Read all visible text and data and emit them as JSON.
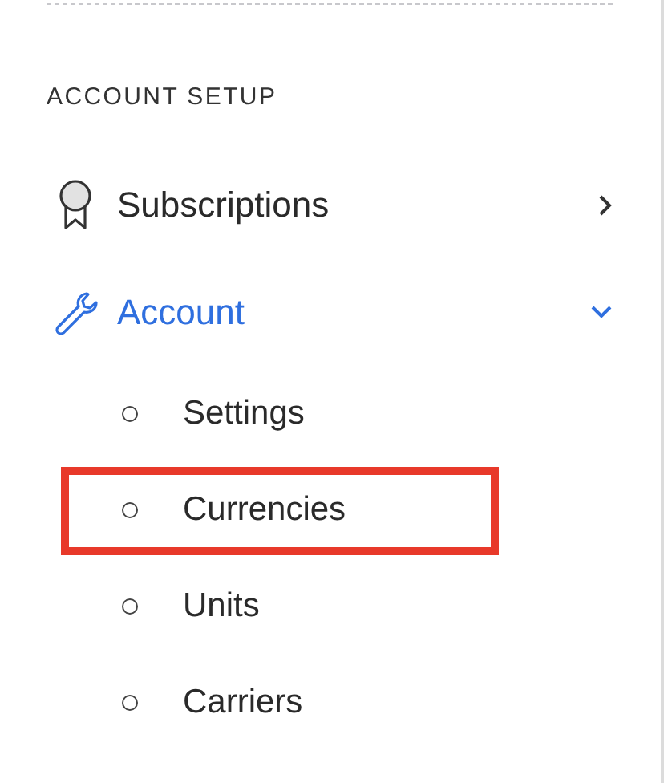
{
  "section": {
    "heading": "ACCOUNT SETUP",
    "items": [
      {
        "label": "Subscriptions",
        "kind": "ribbon",
        "selected": false,
        "expanded": false
      },
      {
        "label": "Account",
        "kind": "wrench",
        "selected": true,
        "expanded": true,
        "children": [
          {
            "label": "Settings",
            "highlighted": false
          },
          {
            "label": "Currencies",
            "highlighted": true
          },
          {
            "label": "Units",
            "highlighted": false
          },
          {
            "label": "Carriers",
            "highlighted": false
          }
        ]
      }
    ]
  }
}
